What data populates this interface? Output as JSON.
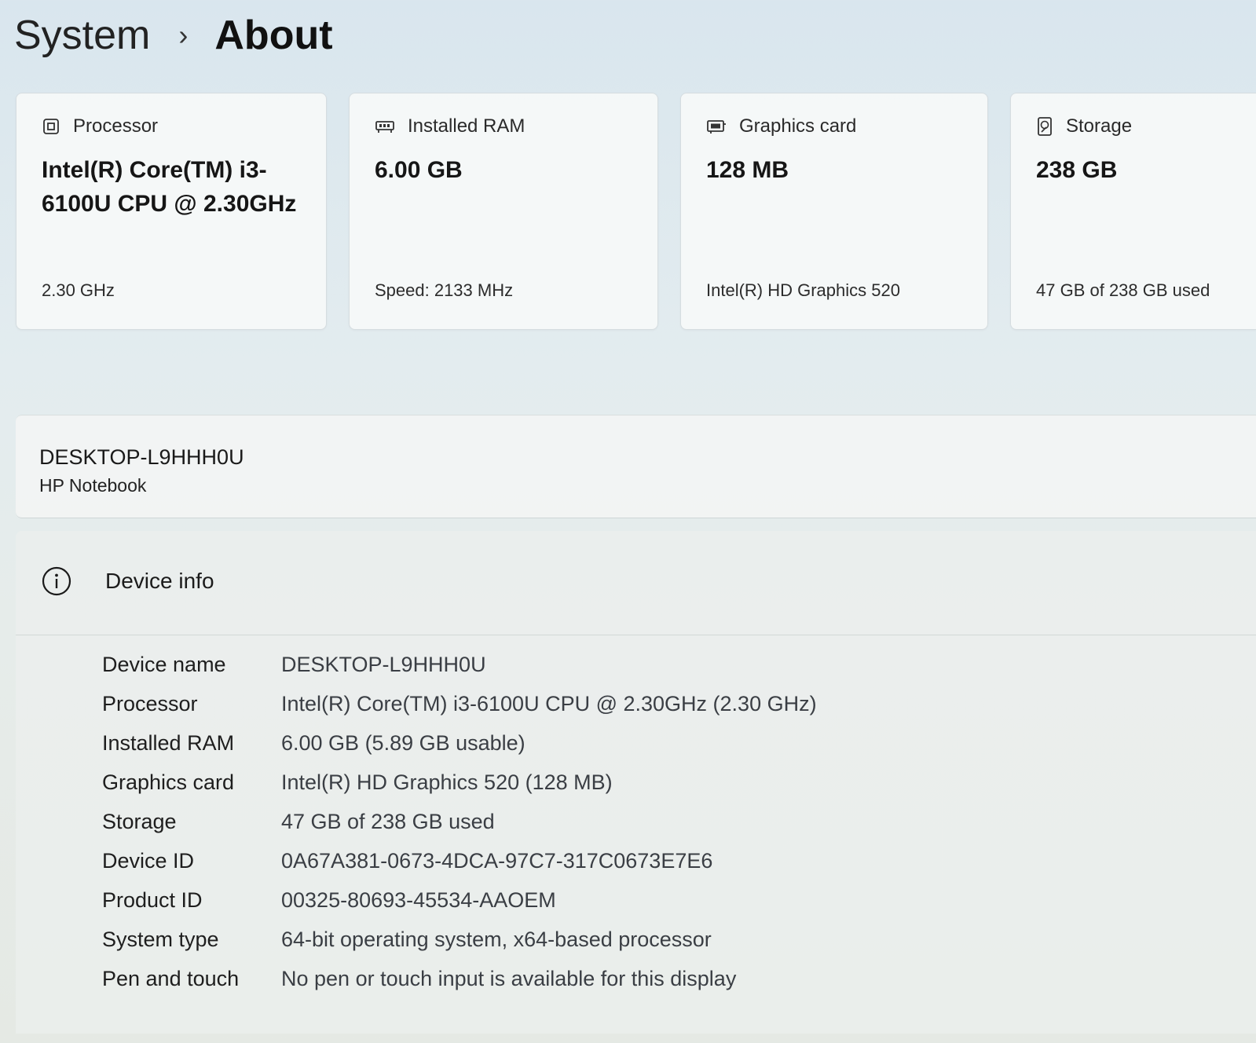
{
  "breadcrumb": {
    "parent": "System",
    "separator": "›",
    "current": "About"
  },
  "cards": [
    {
      "icon": "processor-icon",
      "title": "Processor",
      "value": "Intel(R) Core(TM) i3-6100U CPU @ 2.30GHz",
      "sub": "2.30 GHz"
    },
    {
      "icon": "ram-icon",
      "title": "Installed RAM",
      "value": "6.00 GB",
      "sub": "Speed: 2133 MHz"
    },
    {
      "icon": "graphics-card-icon",
      "title": "Graphics card",
      "value": "128 MB",
      "sub": "Intel(R) HD Graphics 520"
    },
    {
      "icon": "storage-icon",
      "title": "Storage",
      "value": "238 GB",
      "sub": "47 GB of 238 GB used"
    }
  ],
  "device": {
    "name": "DESKTOP-L9HHH0U",
    "model": "HP Notebook"
  },
  "device_info": {
    "title": "Device info",
    "icon": "info-icon",
    "rows": [
      {
        "label": "Device name",
        "value": "DESKTOP-L9HHH0U"
      },
      {
        "label": "Processor",
        "value": "Intel(R) Core(TM) i3-6100U CPU @ 2.30GHz (2.30 GHz)"
      },
      {
        "label": "Installed RAM",
        "value": "6.00 GB (5.89 GB usable)"
      },
      {
        "label": "Graphics card",
        "value": "Intel(R) HD Graphics 520 (128 MB)"
      },
      {
        "label": "Storage",
        "value": "47 GB of 238 GB used"
      },
      {
        "label": "Device ID",
        "value": "0A67A381-0673-4DCA-97C7-317C0673E7E6"
      },
      {
        "label": "Product ID",
        "value": "00325-80693-45534-AAOEM"
      },
      {
        "label": "System type",
        "value": "64-bit operating system, x64-based processor"
      },
      {
        "label": "Pen and touch",
        "value": "No pen or touch input is available for this display"
      }
    ]
  },
  "colors": {
    "accent": "#0067c0",
    "card_background": "#f6f8f8",
    "value_text": "#3a3e44"
  }
}
